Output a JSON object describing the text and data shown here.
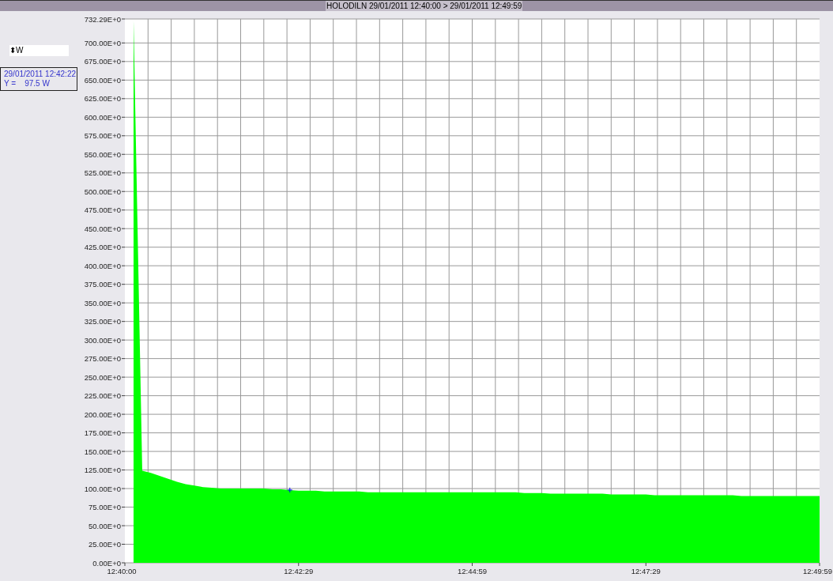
{
  "title_bar": {
    "title": "HOLODILN  29/01/2011 12:40:00 > 29/01/2011 12:49:59"
  },
  "unit_select": {
    "icon": "⬍"
  },
  "readout": {
    "time": "29/01/2011 12:42:22",
    "value": "Y =    97.5 W"
  },
  "chart": {
    "chart_data": {
      "type": "area",
      "categories": [
        "12:40:00",
        null,
        null,
        null,
        null,
        null,
        null,
        null,
        null,
        null,
        null,
        null,
        null,
        null,
        null,
        null,
        null,
        null,
        null,
        null,
        "12:42:29",
        null,
        null,
        null,
        null,
        null,
        null,
        null,
        null,
        null,
        null,
        null,
        null,
        null,
        null,
        null,
        null,
        null,
        null,
        null,
        "12:44:59",
        null,
        null,
        null,
        null,
        null,
        null,
        null,
        null,
        null,
        null,
        null,
        null,
        null,
        null,
        null,
        null,
        null,
        null,
        null,
        "12:47:29",
        null,
        null,
        null,
        null,
        null,
        null,
        null,
        null,
        null,
        null,
        null,
        null,
        null,
        null,
        null,
        null,
        null,
        null,
        null,
        "12:49:59"
      ],
      "series": [
        {
          "name": "W",
          "color": "#00ff00",
          "values": [
            null,
            730,
            124,
            121,
            117,
            113,
            109,
            106,
            104,
            102,
            101,
            100,
            100,
            100,
            100,
            100,
            100,
            99,
            99,
            98,
            97,
            97,
            97,
            96,
            96,
            96,
            96,
            96,
            95,
            95,
            95,
            95,
            95,
            95,
            95,
            95,
            95,
            95,
            95,
            95,
            95,
            95,
            95,
            95,
            95,
            95,
            94,
            94,
            94,
            93,
            93,
            93,
            93,
            93,
            93,
            93,
            92,
            92,
            92,
            92,
            92,
            91,
            91,
            91,
            91,
            91,
            91,
            91,
            91,
            91,
            91,
            90,
            90,
            90,
            90,
            90,
            90,
            90,
            90,
            90,
            90
          ]
        }
      ],
      "ylim": [
        0,
        732.29
      ],
      "yticks": [
        {
          "value": 0,
          "label": "0.00E+0"
        },
        {
          "value": 25,
          "label": "25.00E+0"
        },
        {
          "value": 50,
          "label": "50.00E+0"
        },
        {
          "value": 75,
          "label": "75.00E+0"
        },
        {
          "value": 100,
          "label": "100.00E+0"
        },
        {
          "value": 125,
          "label": "125.00E+0"
        },
        {
          "value": 150,
          "label": "150.00E+0"
        },
        {
          "value": 175,
          "label": "175.00E+0"
        },
        {
          "value": 200,
          "label": "200.00E+0"
        },
        {
          "value": 225,
          "label": "225.00E+0"
        },
        {
          "value": 250,
          "label": "250.00E+0"
        },
        {
          "value": 275,
          "label": "275.00E+0"
        },
        {
          "value": 300,
          "label": "300.00E+0"
        },
        {
          "value": 325,
          "label": "325.00E+0"
        },
        {
          "value": 350,
          "label": "350.00E+0"
        },
        {
          "value": 375,
          "label": "375.00E+0"
        },
        {
          "value": 400,
          "label": "400.00E+0"
        },
        {
          "value": 425,
          "label": "425.00E+0"
        },
        {
          "value": 450,
          "label": "450.00E+0"
        },
        {
          "value": 475,
          "label": "475.00E+0"
        },
        {
          "value": 500,
          "label": "500.00E+0"
        },
        {
          "value": 525,
          "label": "525.00E+0"
        },
        {
          "value": 550,
          "label": "550.00E+0"
        },
        {
          "value": 575,
          "label": "575.00E+0"
        },
        {
          "value": 600,
          "label": "600.00E+0"
        },
        {
          "value": 625,
          "label": "625.00E+0"
        },
        {
          "value": 650,
          "label": "650.00E+0"
        },
        {
          "value": 675,
          "label": "675.00E+0"
        },
        {
          "value": 700,
          "label": "700.00E+0"
        },
        {
          "value": 732.29,
          "label": "732.29E+0"
        }
      ],
      "grid": true
    }
  }
}
